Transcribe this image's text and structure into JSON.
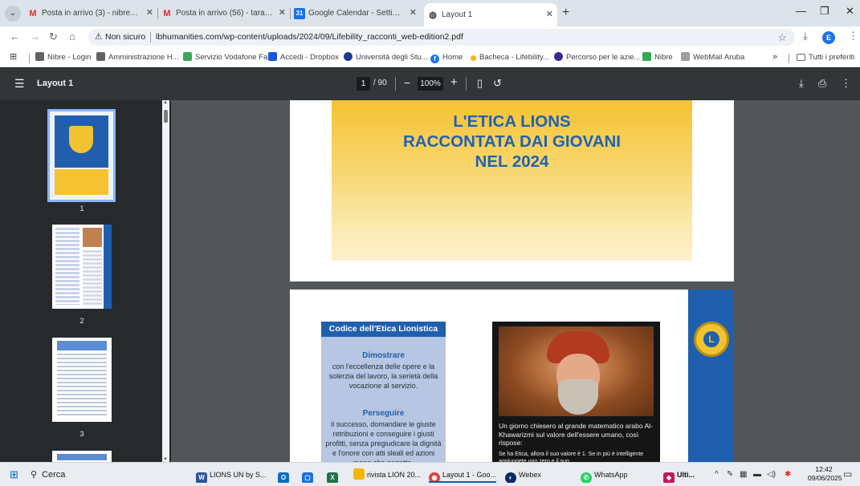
{
  "tabs": [
    {
      "label": "Posta in arrivo (3) - nibresas@",
      "icon": "gmail-icon"
    },
    {
      "label": "Posta in arrivo (56) - taranto.e",
      "icon": "gmail-icon"
    },
    {
      "label": "Google Calendar - Settimana d",
      "icon": "calendar-icon"
    },
    {
      "label": "Layout 1",
      "icon": "globe-icon"
    }
  ],
  "address": {
    "security_label": "Non sicuro",
    "url": "lbhumanities.com/wp-content/uploads/2024/09/Lifebility_racconti_web-edition2.pdf"
  },
  "profile_initial": "E",
  "bookmarks": [
    {
      "label": "Nibre - Login",
      "color": "#5f6368"
    },
    {
      "label": "Amministrazione H...",
      "color": "#5f6368"
    },
    {
      "label": "Servizio Vodafone Fax",
      "color": "#3aa757"
    },
    {
      "label": "Accedi - Dropbox",
      "color": "#1a56db"
    },
    {
      "label": "Università degli Stu...",
      "color": "#1a3d8f"
    },
    {
      "label": "Home",
      "color": "#1877f2"
    },
    {
      "label": "Bacheca - Lifebility...",
      "color": "#f4b400"
    },
    {
      "label": "Percorso per le azie...",
      "color": "#3a2a96"
    },
    {
      "label": "Nibre",
      "color": "#34a853"
    },
    {
      "label": "WebMail Aruba",
      "color": "#9aa0a6"
    }
  ],
  "bookmarks_more": "»",
  "bookmarks_all": "Tutti i preferiti",
  "pdf": {
    "title": "Layout 1",
    "page_current": "1",
    "page_total": "/ 90",
    "zoom": "100%",
    "thumb_numbers": [
      "1",
      "2",
      "3"
    ]
  },
  "page1": {
    "title_lines": [
      "L'ETICA LIONS",
      "RACCONTATA DAI GIOVANI",
      "NEL 2024"
    ]
  },
  "page2": {
    "code_header": "Codice dell'Etica Lionistica",
    "sections": [
      {
        "heading": "Dimostrare",
        "text": "con l'eccellenza delle opere e la solerzia del lavoro, la serietà della vocazione al servizio."
      },
      {
        "heading": "Perseguire",
        "text": "il successo, domandare le giuste retribuzioni e conseguire i giusti profitti, senza pregiudicare la dignità e l'onore con atti sleali ed azioni meno che corrette."
      }
    ],
    "caption": "Un giorno chiesero al grande matematico arabo Al-Khawarizmi sul valore dell'essere umano, così rispose:",
    "caption_small": "Se ha Etica, allora il suo valore è 1. Se in più è intelligente aggiungete uno zero e il suo"
  },
  "taskbar": {
    "search_label": "Cerca",
    "apps": [
      {
        "label": "LIONS UN by S...",
        "color": "#2b579a"
      },
      {
        "label": "",
        "color": "#0f6cbd"
      },
      {
        "label": "",
        "color": "#1e6fd9"
      },
      {
        "label": "",
        "color": "#217346"
      },
      {
        "label": "rivista LION 20...",
        "color": "#f2b705"
      },
      {
        "label": "Layout 1 - Goo...",
        "color": "#db4437"
      },
      {
        "label": "Webex",
        "color": "#0a2a66"
      },
      {
        "label": "WhatsApp",
        "color": "#25d366"
      },
      {
        "label": "Ulti...",
        "color": "#c2185b"
      }
    ],
    "time": "12:42",
    "date": "09/06/2025"
  }
}
